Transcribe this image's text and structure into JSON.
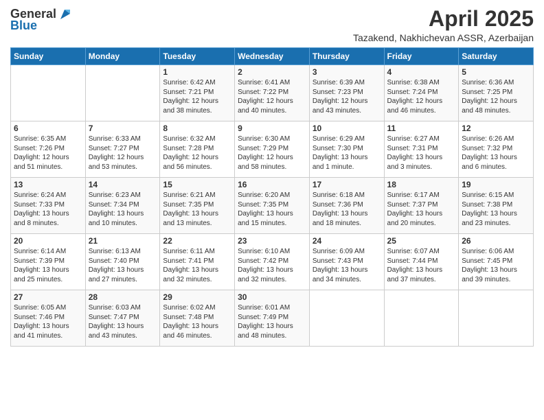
{
  "header": {
    "logo_general": "General",
    "logo_blue": "Blue",
    "month": "April 2025",
    "location": "Tazakend, Nakhichevan ASSR, Azerbaijan"
  },
  "weekdays": [
    "Sunday",
    "Monday",
    "Tuesday",
    "Wednesday",
    "Thursday",
    "Friday",
    "Saturday"
  ],
  "weeks": [
    [
      {
        "day": "",
        "sunrise": "",
        "sunset": "",
        "daylight": ""
      },
      {
        "day": "",
        "sunrise": "",
        "sunset": "",
        "daylight": ""
      },
      {
        "day": "1",
        "sunrise": "Sunrise: 6:42 AM",
        "sunset": "Sunset: 7:21 PM",
        "daylight": "Daylight: 12 hours and 38 minutes."
      },
      {
        "day": "2",
        "sunrise": "Sunrise: 6:41 AM",
        "sunset": "Sunset: 7:22 PM",
        "daylight": "Daylight: 12 hours and 40 minutes."
      },
      {
        "day": "3",
        "sunrise": "Sunrise: 6:39 AM",
        "sunset": "Sunset: 7:23 PM",
        "daylight": "Daylight: 12 hours and 43 minutes."
      },
      {
        "day": "4",
        "sunrise": "Sunrise: 6:38 AM",
        "sunset": "Sunset: 7:24 PM",
        "daylight": "Daylight: 12 hours and 46 minutes."
      },
      {
        "day": "5",
        "sunrise": "Sunrise: 6:36 AM",
        "sunset": "Sunset: 7:25 PM",
        "daylight": "Daylight: 12 hours and 48 minutes."
      }
    ],
    [
      {
        "day": "6",
        "sunrise": "Sunrise: 6:35 AM",
        "sunset": "Sunset: 7:26 PM",
        "daylight": "Daylight: 12 hours and 51 minutes."
      },
      {
        "day": "7",
        "sunrise": "Sunrise: 6:33 AM",
        "sunset": "Sunset: 7:27 PM",
        "daylight": "Daylight: 12 hours and 53 minutes."
      },
      {
        "day": "8",
        "sunrise": "Sunrise: 6:32 AM",
        "sunset": "Sunset: 7:28 PM",
        "daylight": "Daylight: 12 hours and 56 minutes."
      },
      {
        "day": "9",
        "sunrise": "Sunrise: 6:30 AM",
        "sunset": "Sunset: 7:29 PM",
        "daylight": "Daylight: 12 hours and 58 minutes."
      },
      {
        "day": "10",
        "sunrise": "Sunrise: 6:29 AM",
        "sunset": "Sunset: 7:30 PM",
        "daylight": "Daylight: 13 hours and 1 minute."
      },
      {
        "day": "11",
        "sunrise": "Sunrise: 6:27 AM",
        "sunset": "Sunset: 7:31 PM",
        "daylight": "Daylight: 13 hours and 3 minutes."
      },
      {
        "day": "12",
        "sunrise": "Sunrise: 6:26 AM",
        "sunset": "Sunset: 7:32 PM",
        "daylight": "Daylight: 13 hours and 6 minutes."
      }
    ],
    [
      {
        "day": "13",
        "sunrise": "Sunrise: 6:24 AM",
        "sunset": "Sunset: 7:33 PM",
        "daylight": "Daylight: 13 hours and 8 minutes."
      },
      {
        "day": "14",
        "sunrise": "Sunrise: 6:23 AM",
        "sunset": "Sunset: 7:34 PM",
        "daylight": "Daylight: 13 hours and 10 minutes."
      },
      {
        "day": "15",
        "sunrise": "Sunrise: 6:21 AM",
        "sunset": "Sunset: 7:35 PM",
        "daylight": "Daylight: 13 hours and 13 minutes."
      },
      {
        "day": "16",
        "sunrise": "Sunrise: 6:20 AM",
        "sunset": "Sunset: 7:35 PM",
        "daylight": "Daylight: 13 hours and 15 minutes."
      },
      {
        "day": "17",
        "sunrise": "Sunrise: 6:18 AM",
        "sunset": "Sunset: 7:36 PM",
        "daylight": "Daylight: 13 hours and 18 minutes."
      },
      {
        "day": "18",
        "sunrise": "Sunrise: 6:17 AM",
        "sunset": "Sunset: 7:37 PM",
        "daylight": "Daylight: 13 hours and 20 minutes."
      },
      {
        "day": "19",
        "sunrise": "Sunrise: 6:15 AM",
        "sunset": "Sunset: 7:38 PM",
        "daylight": "Daylight: 13 hours and 23 minutes."
      }
    ],
    [
      {
        "day": "20",
        "sunrise": "Sunrise: 6:14 AM",
        "sunset": "Sunset: 7:39 PM",
        "daylight": "Daylight: 13 hours and 25 minutes."
      },
      {
        "day": "21",
        "sunrise": "Sunrise: 6:13 AM",
        "sunset": "Sunset: 7:40 PM",
        "daylight": "Daylight: 13 hours and 27 minutes."
      },
      {
        "day": "22",
        "sunrise": "Sunrise: 6:11 AM",
        "sunset": "Sunset: 7:41 PM",
        "daylight": "Daylight: 13 hours and 32 minutes."
      },
      {
        "day": "23",
        "sunrise": "Sunrise: 6:10 AM",
        "sunset": "Sunset: 7:42 PM",
        "daylight": "Daylight: 13 hours and 32 minutes."
      },
      {
        "day": "24",
        "sunrise": "Sunrise: 6:09 AM",
        "sunset": "Sunset: 7:43 PM",
        "daylight": "Daylight: 13 hours and 34 minutes."
      },
      {
        "day": "25",
        "sunrise": "Sunrise: 6:07 AM",
        "sunset": "Sunset: 7:44 PM",
        "daylight": "Daylight: 13 hours and 37 minutes."
      },
      {
        "day": "26",
        "sunrise": "Sunrise: 6:06 AM",
        "sunset": "Sunset: 7:45 PM",
        "daylight": "Daylight: 13 hours and 39 minutes."
      }
    ],
    [
      {
        "day": "27",
        "sunrise": "Sunrise: 6:05 AM",
        "sunset": "Sunset: 7:46 PM",
        "daylight": "Daylight: 13 hours and 41 minutes."
      },
      {
        "day": "28",
        "sunrise": "Sunrise: 6:03 AM",
        "sunset": "Sunset: 7:47 PM",
        "daylight": "Daylight: 13 hours and 43 minutes."
      },
      {
        "day": "29",
        "sunrise": "Sunrise: 6:02 AM",
        "sunset": "Sunset: 7:48 PM",
        "daylight": "Daylight: 13 hours and 46 minutes."
      },
      {
        "day": "30",
        "sunrise": "Sunrise: 6:01 AM",
        "sunset": "Sunset: 7:49 PM",
        "daylight": "Daylight: 13 hours and 48 minutes."
      },
      {
        "day": "",
        "sunrise": "",
        "sunset": "",
        "daylight": ""
      },
      {
        "day": "",
        "sunrise": "",
        "sunset": "",
        "daylight": ""
      },
      {
        "day": "",
        "sunrise": "",
        "sunset": "",
        "daylight": ""
      }
    ]
  ]
}
